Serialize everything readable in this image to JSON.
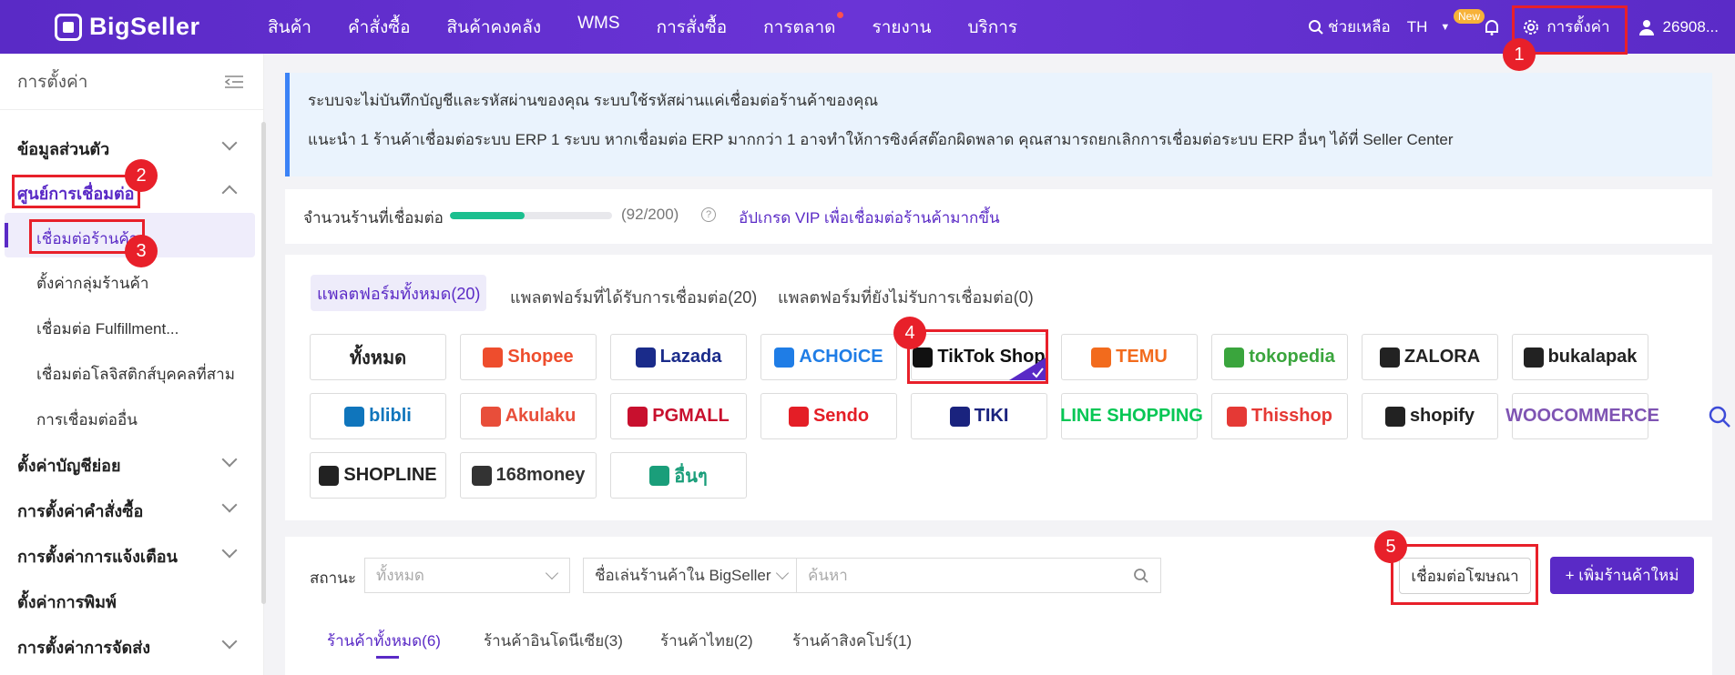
{
  "brand": "BigSeller",
  "nav": [
    "สินค้า",
    "คำสั่งซื้อ",
    "สินค้าคงคลัง",
    "WMS",
    "การสั่งซื้อ",
    "การตลาด",
    "รายงาน",
    "บริการ"
  ],
  "top_right": {
    "help": "ช่วยเหลือ",
    "lang": "TH",
    "new_badge": "New",
    "settings": "การตั้งค่า",
    "user": "26908..."
  },
  "sidebar": {
    "title": "การตั้งค่า",
    "items": [
      {
        "label": "ข้อมูลส่วนตัว"
      },
      {
        "label": "ศูนย์การเชื่อมต่อ"
      },
      {
        "label": "ตั้งค่าบัญชีย่อย"
      },
      {
        "label": "การตั้งค่าคำสั่งซื้อ"
      },
      {
        "label": "การตั้งค่าการแจ้งเตือน"
      },
      {
        "label": "ตั้งค่าการพิมพ์"
      },
      {
        "label": "การตั้งค่าการจัดส่ง"
      }
    ],
    "subitems": [
      {
        "label": "เชื่อมต่อร้านค้า"
      },
      {
        "label": "ตั้งค่ากลุ่มร้านค้า"
      },
      {
        "label": "เชื่อมต่อ Fulfillment..."
      },
      {
        "label": "เชื่อมต่อโลจิสติกส์บุคคลที่สาม"
      },
      {
        "label": "การเชื่อมต่ออื่น"
      }
    ]
  },
  "notice": {
    "line1": "ระบบจะไม่บันทึกบัญชีและรหัสผ่านของคุณ ระบบใช้รหัสผ่านแค่เชื่อมต่อร้านค้าของคุณ",
    "line2": "แนะนำ 1 ร้านค้าเชื่อมต่อระบบ ERP 1 ระบบ หากเชื่อมต่อ ERP มากกว่า 1 อาจทำให้การซิงค์สต๊อกผิดพลาด คุณสามารถยกเลิกการเชื่อมต่อระบบ ERP อื่นๆ ได้ที่ Seller Center"
  },
  "shops": {
    "label": "จำนวนร้านที่เชื่อมต่อ",
    "count_text": "(92/200)",
    "fraction": 0.46,
    "upgrade": "อัปเกรด VIP เพื่อเชื่อมต่อร้านค้ามากขึ้น"
  },
  "platform_tabs": [
    "แพลตฟอร์มทั้งหมด(20)",
    "แพลตฟอร์มที่ได้รับการเชื่อมต่อ(20)",
    "แพลตฟอร์มที่ยังไม่รับการเชื่อมต่อ(0)"
  ],
  "platforms": [
    {
      "label": "ทั้งหมด",
      "color": "#222222"
    },
    {
      "label": "Shopee",
      "color": "#ee4d2d"
    },
    {
      "label": "Lazada",
      "color": "#1a2b8a"
    },
    {
      "label": "ACHOiCE",
      "color": "#1f7de6"
    },
    {
      "label": "TikTok Shop",
      "color": "#111111"
    },
    {
      "label": "TEMU",
      "color": "#f26b1d"
    },
    {
      "label": "tokopedia",
      "color": "#3aa53d"
    },
    {
      "label": "ZALORA",
      "color": "#222222"
    },
    {
      "label": "bukalapak",
      "color": "#222222"
    },
    {
      "label": "blibli",
      "color": "#0f75bc"
    },
    {
      "label": "Akulaku",
      "color": "#e84e3a"
    },
    {
      "label": "PGMALL",
      "color": "#c8102e"
    },
    {
      "label": "Sendo",
      "color": "#e41e26"
    },
    {
      "label": "TIKI",
      "color": "#1a237e"
    },
    {
      "label": "LINE SHOPPING",
      "color": "#06c755"
    },
    {
      "label": "Thisshop",
      "color": "#e53935"
    },
    {
      "label": "shopify",
      "color": "#222222"
    },
    {
      "label": "WOOCOMMERCE",
      "color": "#7f54b3"
    },
    {
      "label": "SHOPLINE",
      "color": "#222222"
    },
    {
      "label": "168money",
      "color": "#333333"
    },
    {
      "label": "อื่นๆ",
      "color": "#1a9e7a"
    }
  ],
  "filters": {
    "status_label": "สถานะ",
    "status_value": "ทั้งหมด",
    "shop_name_select": "ชื่อเล่นร้านค้าใน BigSeller",
    "search_placeholder": "ค้นหา",
    "connect_ads": "เชื่อมต่อโฆษณา",
    "add_shop": "+ เพิ่มร้านค้าใหม่"
  },
  "bottom_tabs": [
    "ร้านค้าทั้งหมด(6)",
    "ร้านค้าอินโดนีเซีย(3)",
    "ร้านค้าไทย(2)",
    "ร้านค้าสิงคโปร์(1)"
  ],
  "step_badges": [
    "1",
    "2",
    "3",
    "4",
    "5"
  ]
}
